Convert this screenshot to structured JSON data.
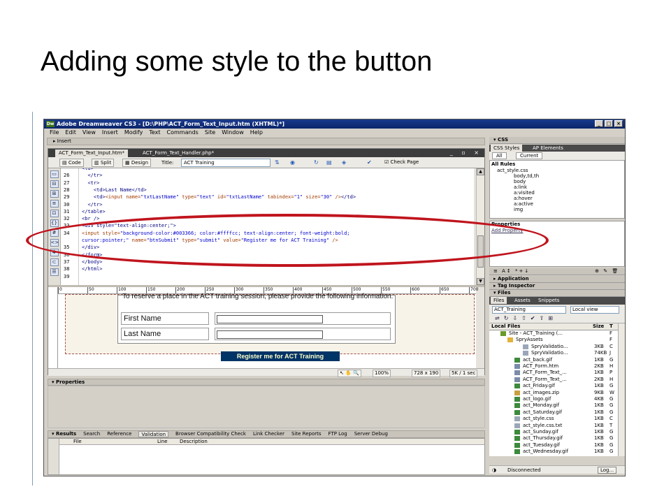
{
  "slide": {
    "title": "Adding some style to the button"
  },
  "app": {
    "window_title": "Adobe Dreamweaver CS3 - [D:\\PHP\\ACT_Form_Text_Input.htm (XHTML)*]",
    "app_badge": "Dw",
    "menu": [
      "File",
      "Edit",
      "View",
      "Insert",
      "Modify",
      "Text",
      "Commands",
      "Site",
      "Window",
      "Help"
    ],
    "insert_bar_label": "Insert",
    "doc_tabs": [
      "ACT_Form_Text_Input.htm*",
      "ACT_Form_Text_Handler.php*"
    ],
    "toolbar": {
      "code": "Code",
      "split": "Split",
      "design": "Design",
      "title_label": "Title:",
      "title_value": "ACT Training",
      "check_page": "Check Page"
    },
    "code_lines": [
      {
        "n": "",
        "html": "<span class='tag'>&lt;td&gt;</span>",
        "indent": ""
      },
      {
        "n": "26",
        "html": "<span class='tag'>&lt;/tr&gt;</span>",
        "indent": "  "
      },
      {
        "n": "27",
        "html": "<span class='tag'>&lt;tr&gt;</span>",
        "indent": "  "
      },
      {
        "n": "28",
        "html": "<span class='tag'>&lt;td&gt;</span>Last Name<span class='tag'>&lt;/td&gt;</span>",
        "indent": "    "
      },
      {
        "n": "29",
        "html": "<span class='tag'>&lt;td&gt;</span><span class='attr'>&lt;input name=</span><span class='val'>\"txtLastName\"</span><span class='attr'> type=</span><span class='val'>\"text\"</span><span class='attr'> id=</span><span class='val'>\"txtLastName\"</span><span class='attr'> tabindex=</span><span class='val'>\"1\"</span><span class='attr'> size=</span><span class='val'>\"30\"</span><span class='attr'> /&gt;</span><span class='tag'>&lt;/td&gt;</span>",
        "indent": "    "
      },
      {
        "n": "30",
        "html": "<span class='tag'>&lt;/tr&gt;</span>",
        "indent": "  "
      },
      {
        "n": "31",
        "html": "<span class='tag'>&lt;/table&gt;</span>",
        "indent": ""
      },
      {
        "n": "32",
        "html": "<span class='tag'>&lt;br /&gt;</span>",
        "indent": ""
      },
      {
        "n": "33",
        "html": "<span class='tag'>&lt;div style=\"text-align:center;\"&gt;</span>",
        "indent": ""
      },
      {
        "n": "34",
        "html": "<span class='attr'>&lt;input style=</span><span class='val'>\"background-color:#003366; color:#ffffcc; text-align:center; font-weight:bold;</span>",
        "indent": ""
      },
      {
        "n": "",
        "html": "<span class='val'>cursor:pointer;\"</span><span class='attr'> name=</span><span class='val'>\"btnSubmit\"</span><span class='attr'> type=</span><span class='val'>\"submit\"</span><span class='attr'> value=</span><span class='val'>\"Register me for ACT Training\"</span><span class='attr'> /&gt;</span>",
        "indent": ""
      },
      {
        "n": "35",
        "html": "<span class='tag'>&lt;/div&gt;</span>",
        "indent": ""
      },
      {
        "n": "36",
        "html": "<span class='tag'>&lt;/form&gt;</span>",
        "indent": ""
      },
      {
        "n": "37",
        "html": "<span class='tag'>&lt;/body&gt;</span>",
        "indent": ""
      },
      {
        "n": "38",
        "html": "<span class='tag'>&lt;/html&gt;</span>",
        "indent": ""
      },
      {
        "n": "39",
        "html": "",
        "indent": ""
      }
    ],
    "ruler_ticks": [
      "0",
      "50",
      "100",
      "150",
      "200",
      "250",
      "300",
      "350",
      "400",
      "450",
      "500",
      "550",
      "600",
      "650",
      "700"
    ],
    "design": {
      "intro": "To reserve a place in the ACT training session, please provide the following information.",
      "first_name": "First Name",
      "last_name": "Last Name",
      "submit": "Register me for ACT Training"
    },
    "status": {
      "zoom": "100%",
      "size": "728 x 190",
      "speed": "5K / 1 sec"
    },
    "properties_label": "Properties",
    "results": {
      "label": "Results",
      "tabs": [
        "Search",
        "Reference",
        "Validation",
        "Browser Compatibility Check",
        "Link Checker",
        "Site Reports",
        "FTP Log",
        "Server Debug"
      ],
      "active_tab": "Validation",
      "cols": [
        "File",
        "Line",
        "Description"
      ]
    },
    "panels": {
      "css_header": "CSS",
      "css_tabs": [
        "CSS Styles",
        "AP Elements"
      ],
      "all": "All",
      "current": "Current",
      "all_rules": "All Rules",
      "rules": [
        "act_style.css",
        "body,td,th",
        "body",
        "a:link",
        "a:visited",
        "a:hover",
        "a:active",
        "img"
      ],
      "properties": "Properties",
      "add_property": "Add Property",
      "application": "Application",
      "tag_inspector": "Tag Inspector",
      "files_header": "Files",
      "files_tabs": [
        "Files",
        "Assets",
        "Snippets"
      ],
      "site": "ACT_Training",
      "view": "Local view",
      "local_files": "Local Files",
      "size_col": "Size",
      "type_col": "T",
      "files": [
        {
          "name": "Site - ACT_Training (...",
          "size": "",
          "type": "F",
          "kind": "site"
        },
        {
          "name": "SpryAssets",
          "size": "",
          "type": "F",
          "kind": "folder"
        },
        {
          "name": "SpryValidatio...",
          "size": "3KB",
          "type": "C",
          "kind": "file"
        },
        {
          "name": "SpryValidatio...",
          "size": "74KB",
          "type": "J",
          "kind": "file"
        },
        {
          "name": "act_back.gif",
          "size": "1KB",
          "type": "G",
          "kind": "img"
        },
        {
          "name": "ACT_Form.htm",
          "size": "2KB",
          "type": "H",
          "kind": "html"
        },
        {
          "name": "ACT_Form_Text_...",
          "size": "1KB",
          "type": "P",
          "kind": "html"
        },
        {
          "name": "ACT_Form_Text_...",
          "size": "2KB",
          "type": "H",
          "kind": "html"
        },
        {
          "name": "act_Friday.gif",
          "size": "1KB",
          "type": "G",
          "kind": "img"
        },
        {
          "name": "act_images.zip",
          "size": "9KB",
          "type": "W",
          "kind": "zip"
        },
        {
          "name": "act_logo.gif",
          "size": "4KB",
          "type": "G",
          "kind": "img"
        },
        {
          "name": "act_Monday.gif",
          "size": "1KB",
          "type": "G",
          "kind": "img"
        },
        {
          "name": "act_Saturday.gif",
          "size": "1KB",
          "type": "G",
          "kind": "img"
        },
        {
          "name": "act_style.css",
          "size": "1KB",
          "type": "C",
          "kind": "file"
        },
        {
          "name": "act_style.css.txt",
          "size": "1KB",
          "type": "T",
          "kind": "file"
        },
        {
          "name": "act_Sunday.gif",
          "size": "1KB",
          "type": "G",
          "kind": "img"
        },
        {
          "name": "act_Thursday.gif",
          "size": "1KB",
          "type": "G",
          "kind": "img"
        },
        {
          "name": "act_Tuesday.gif",
          "size": "1KB",
          "type": "G",
          "kind": "img"
        },
        {
          "name": "act_Wednesday.gif",
          "size": "1KB",
          "type": "G",
          "kind": "img"
        }
      ],
      "connection": "Disconnected",
      "log": "Log..."
    }
  },
  "colors": {
    "annotation": "#c0141d",
    "button_bg": "#003366",
    "button_fg": "#ffffcc"
  }
}
